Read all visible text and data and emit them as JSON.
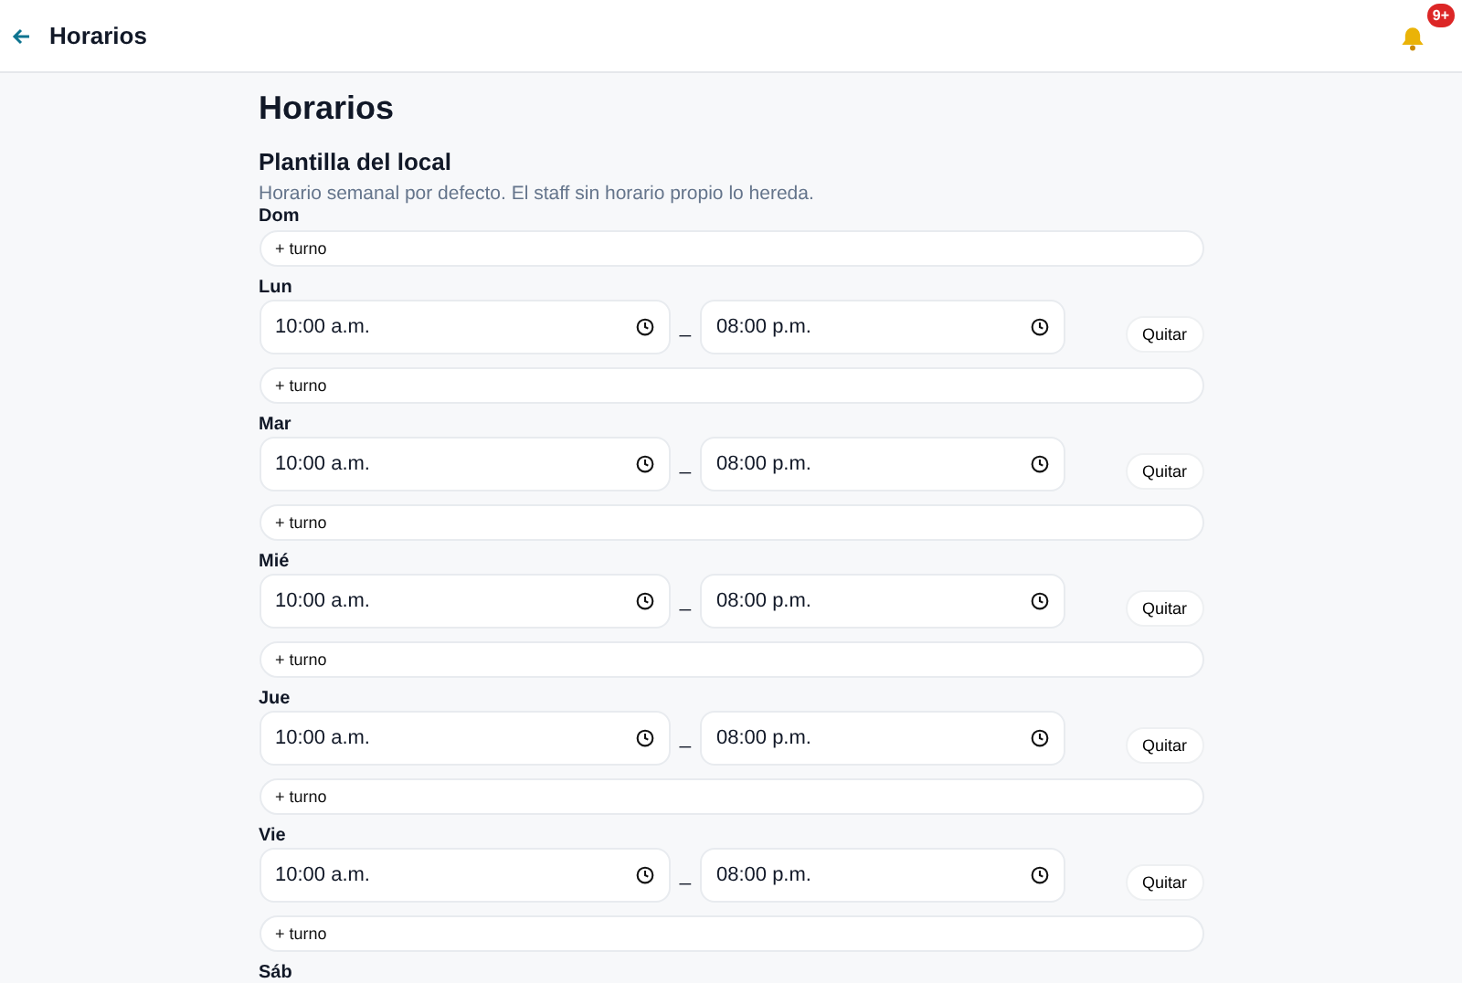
{
  "header": {
    "title": "Horarios",
    "notification_badge": "9+"
  },
  "page_title": "Horarios",
  "section": {
    "title": "Plantilla del local",
    "description": "Horario semanal por defecto. El staff sin horario propio lo hereda."
  },
  "days": [
    {
      "label": "Dom",
      "add_label": "+ turno"
    },
    {
      "label": "Lun",
      "shifts": [
        {
          "start": "10:00 a.m.",
          "separator": "_",
          "end": "08:00 p.m.",
          "remove_label": "Quitar"
        }
      ],
      "add_label": "+ turno"
    },
    {
      "label": "Mar",
      "shifts": [
        {
          "start": "10:00 a.m.",
          "separator": "_",
          "end": "08:00 p.m.",
          "remove_label": "Quitar"
        }
      ],
      "add_label": "+ turno"
    },
    {
      "label": "Mié",
      "shifts": [
        {
          "start": "10:00 a.m.",
          "separator": "_",
          "end": "08:00 p.m.",
          "remove_label": "Quitar"
        }
      ],
      "add_label": "+ turno"
    },
    {
      "label": "Jue",
      "shifts": [
        {
          "start": "10:00 a.m.",
          "separator": "_",
          "end": "08:00 p.m.",
          "remove_label": "Quitar"
        }
      ],
      "add_label": "+ turno"
    },
    {
      "label": "Vie",
      "shifts": [
        {
          "start": "10:00 a.m.",
          "separator": "_",
          "end": "08:00 p.m.",
          "remove_label": "Quitar"
        }
      ],
      "add_label": "+ turno"
    },
    {
      "label": "Sáb"
    }
  ]
}
